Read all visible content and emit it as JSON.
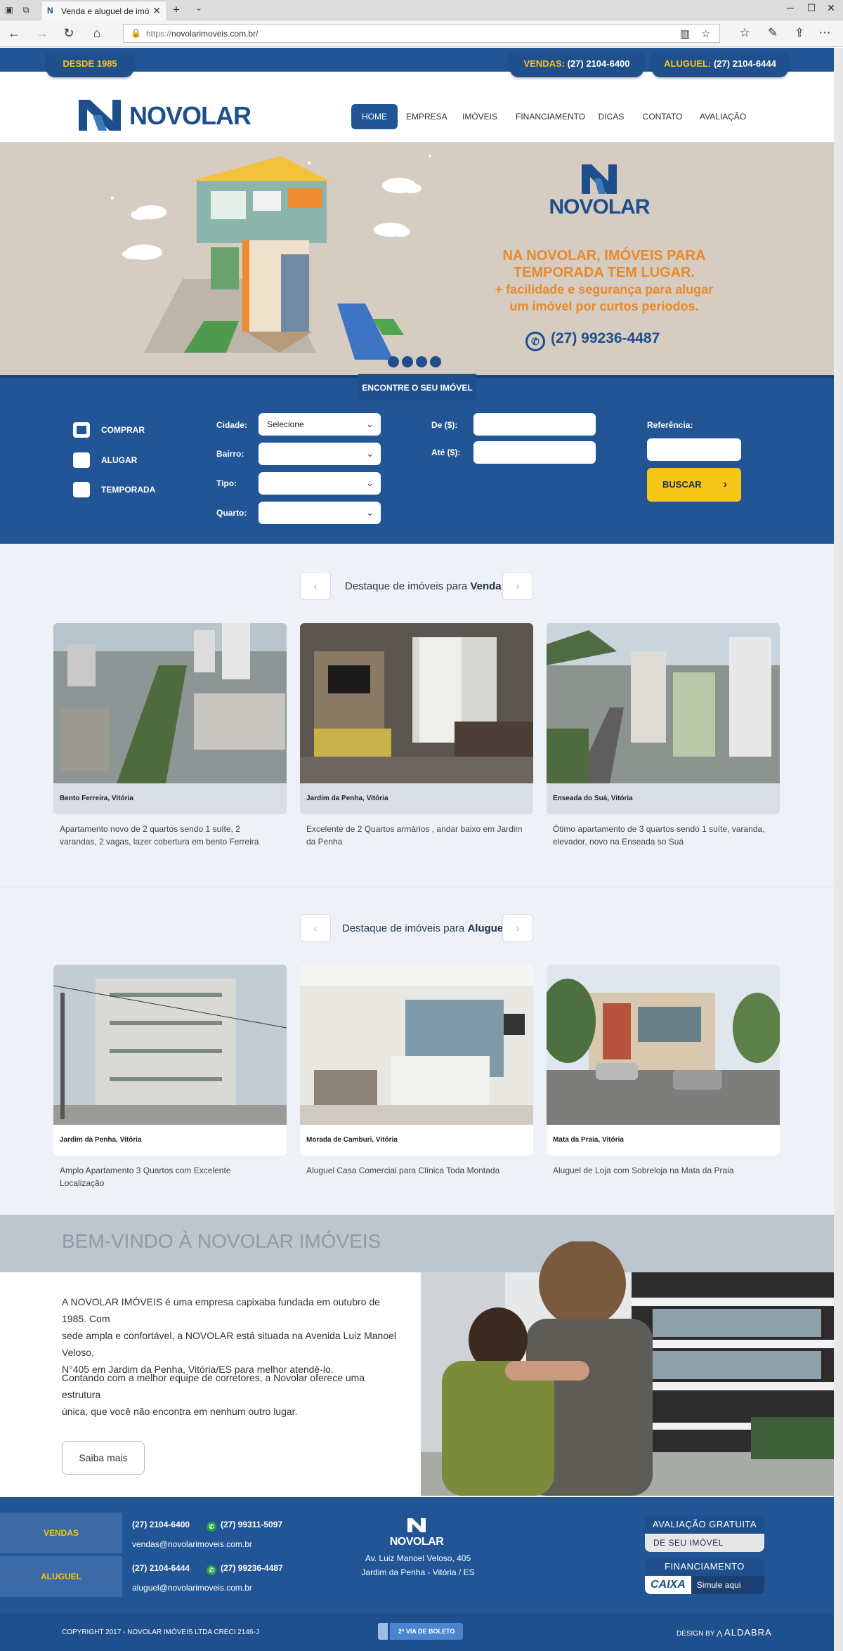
{
  "browser": {
    "tab_title": "Venda e aluguel de imó",
    "url_prefix": "https://",
    "url_main": "novolarimoveis.com.br/"
  },
  "topbar": {
    "since": "DESDE 1985",
    "vendas_label": "VENDAS:",
    "vendas_phone": "(27) 2104-6400",
    "aluguel_label": "ALUGUEL:",
    "aluguel_phone": "(27) 2104-6444"
  },
  "brand": {
    "name": "NOVOLAR"
  },
  "nav": {
    "items": [
      "HOME",
      "EMPRESA",
      "IMÓVEIS",
      "FINANCIAMENTO",
      "DICAS",
      "CONTATO",
      "AVALIAÇÃO"
    ],
    "active": "HOME"
  },
  "hero": {
    "logo": "NOVOLAR",
    "headline_1": "NA NOVOLAR, IMÓVEIS PARA",
    "headline_2": "TEMPORADA TEM LUGAR.",
    "sub_1": "+ facilidade e segurança para alugar",
    "sub_2": "um imóvel por curtos periodos.",
    "phone": "(27) 99236-4487",
    "slides": 4
  },
  "search": {
    "tab_label": "ENCONTRE O SEU IMÓVEL",
    "modes": [
      {
        "label": "COMPRAR",
        "checked": true
      },
      {
        "label": "ALUGAR",
        "checked": false
      },
      {
        "label": "TEMPORADA",
        "checked": false
      }
    ],
    "cidade_label": "Cidade:",
    "cidade_value": "Selecione",
    "bairro_label": "Bairro:",
    "tipo_label": "Tipo:",
    "quarto_label": "Quarto:",
    "de_label": "De ($):",
    "ate_label": "Até ($):",
    "referencia_label": "Referência:",
    "buscar_label": "BUSCAR"
  },
  "venda": {
    "title_prefix": "Destaque de imóveis para",
    "title_bold": "Venda",
    "cards": [
      {
        "location": "Bento Ferreira, Vitória",
        "desc": "Apartamento novo de 2 quartos sendo 1 suíte, 2 varandas, 2 vagas, lazer cobertura em bento Ferreira"
      },
      {
        "location": "Jardim da Penha, Vitória",
        "desc": "Excelente de 2 Quartos armários , andar baixo em Jardim da Penha"
      },
      {
        "location": "Enseada do Suá, Vitória",
        "desc": "Ótimo apartamento de 3 quartos sendo 1 suíte, varanda, elevador, novo na Enseada so Suá"
      }
    ]
  },
  "aluguel": {
    "title_prefix": "Destaque de imóveis para",
    "title_bold": "Aluguel",
    "cards": [
      {
        "location": "Jardim da Penha, Vitória",
        "desc": "Amplo Apartamento 3 Quartos com Excelente Localização"
      },
      {
        "location": "Morada de Camburi, Vitória",
        "desc": "Aluguel Casa Comercial para Clínica Toda Montada"
      },
      {
        "location": "Mata da Praia, Vitória",
        "desc": "Aluguel de Loja com Sobreloja na Mata da Praia"
      }
    ]
  },
  "welcome": {
    "title": "BEM-VINDO À NOVOLAR IMÓVEIS",
    "p1_l1": "A NOVOLAR IMÓVEIS é uma empresa capixaba fundada em outubro de 1985. Com",
    "p1_l2": "sede ampla e confortável, a NOVOLAR está situada na Avenida Luiz Manoel Veloso,",
    "p1_l3": "N°405 em Jardim da Penha, Vitória/ES para melhor atendê-lo.",
    "p2_l1": "Contando com a melhor equipe de corretores, a Novolar oferece uma estrutura",
    "p2_l2": "única, que você não encontra em nenhum outro lugar.",
    "button": "Saiba mais"
  },
  "footer": {
    "vendas_label": "VENDAS",
    "vendas_phone": "(27) 2104-6400",
    "vendas_whatsapp": "(27) 99311-5097",
    "vendas_email": "vendas@novolarimoveis.com.br",
    "aluguel_label": "ALUGUEL",
    "aluguel_phone": "(27) 2104-6444",
    "aluguel_whatsapp": "(27) 99236-4487",
    "aluguel_email": "aluguel@novolarimoveis.com.br",
    "logo": "NOVOLAR",
    "address_1": "Av. Luiz Manoel Veloso, 405",
    "address_2": "Jardim da Penha - Vitória / ES",
    "badge1_top": "AVALIAÇÃO GRATUITA",
    "badge1_bot": "DE SEU IMÓVEL",
    "badge2_top": "FINANCIAMENTO",
    "badge2_caixa": "CAIXA",
    "badge2_sim": "Simule aqui",
    "copyright": "COPYRIGHT 2017 - NOVOLAR IMÓVEIS LTDA CRECI 2146-J",
    "boleto": "2ª VIA DE BOLETO",
    "design_by": "DESIGN BY",
    "design_brand": "ALDABRA"
  },
  "colors": {
    "primary": "#215596",
    "accent": "#f5c518",
    "hero_orange": "#e8892b"
  }
}
